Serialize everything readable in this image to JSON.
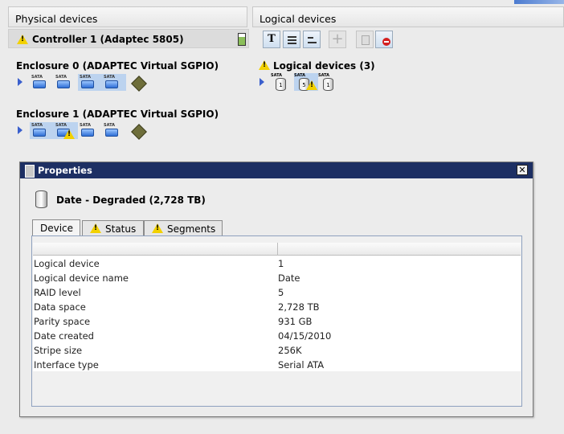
{
  "panels": {
    "physical_title": "Physical devices",
    "logical_title": "Logical devices"
  },
  "controller": {
    "label": "Controller 1 (Adaptec 5805)"
  },
  "enclosures": [
    {
      "label": "Enclosure 0 (ADAPTEC Virtual SGPIO)",
      "devices": [
        "SATA",
        "SATA",
        "SATA",
        "SATA"
      ]
    },
    {
      "label": "Enclosure 1 (ADAPTEC Virtual SGPIO)",
      "devices": [
        "SATA",
        "SATA",
        "SATA",
        "SATA"
      ]
    }
  ],
  "logical": {
    "group_label": "Logical devices (3)",
    "devices": [
      {
        "kind": "SATA",
        "number": "1"
      },
      {
        "kind": "SATA",
        "number": "5"
      },
      {
        "kind": "SATA",
        "number": "1"
      }
    ]
  },
  "toolbar": {
    "text_view_glyph": "T"
  },
  "dialog": {
    "title": "Properties",
    "heading": "Date - Degraded (2,728 TB)",
    "tabs": [
      "Device",
      "Status",
      "Segments"
    ],
    "rows": [
      {
        "label": "Logical device",
        "value": "1"
      },
      {
        "label": "Logical device name",
        "value": "Date"
      },
      {
        "label": "RAID level",
        "value": "5"
      },
      {
        "label": "Data space",
        "value": "2,728 TB"
      },
      {
        "label": "Parity space",
        "value": "931 GB"
      },
      {
        "label": "Date created",
        "value": "04/15/2010"
      },
      {
        "label": "Stripe size",
        "value": "256K"
      },
      {
        "label": "Interface type",
        "value": "Serial ATA"
      }
    ]
  },
  "colors": {
    "titlebar": "#1d2f63",
    "selection": "#bcd3ef",
    "warning": "#f2d100"
  }
}
